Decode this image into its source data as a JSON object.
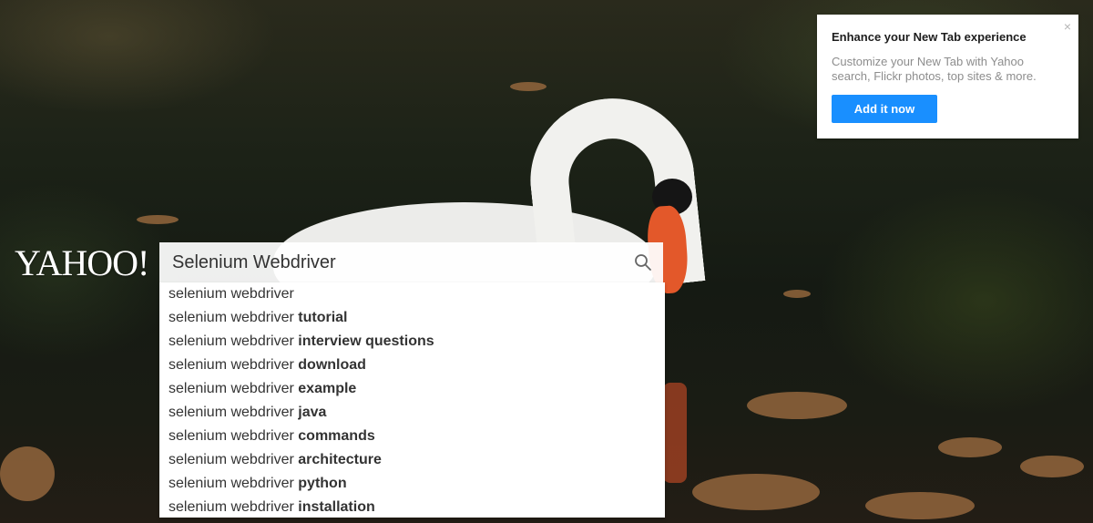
{
  "logo": {
    "text": "YAHOO!"
  },
  "search": {
    "query": "Selenium Webdriver",
    "icon": "search-icon"
  },
  "suggestions": [
    {
      "base": "selenium webdriver",
      "suffix": ""
    },
    {
      "base": "selenium webdriver ",
      "suffix": "tutorial"
    },
    {
      "base": "selenium webdriver ",
      "suffix": "interview questions"
    },
    {
      "base": "selenium webdriver ",
      "suffix": "download"
    },
    {
      "base": "selenium webdriver ",
      "suffix": "example"
    },
    {
      "base": "selenium webdriver ",
      "suffix": "java"
    },
    {
      "base": "selenium webdriver ",
      "suffix": "commands"
    },
    {
      "base": "selenium webdriver ",
      "suffix": "architecture"
    },
    {
      "base": "selenium webdriver ",
      "suffix": "python"
    },
    {
      "base": "selenium webdriver ",
      "suffix": "installation"
    }
  ],
  "promo": {
    "title": "Enhance your New Tab experience",
    "text": "Customize your New Tab with Yahoo search, Flickr photos, top sites & more.",
    "button": "Add it now",
    "close": "×",
    "close_icon": "close-icon"
  },
  "colors": {
    "accent": "#198fff",
    "beak": "#e3582a"
  }
}
